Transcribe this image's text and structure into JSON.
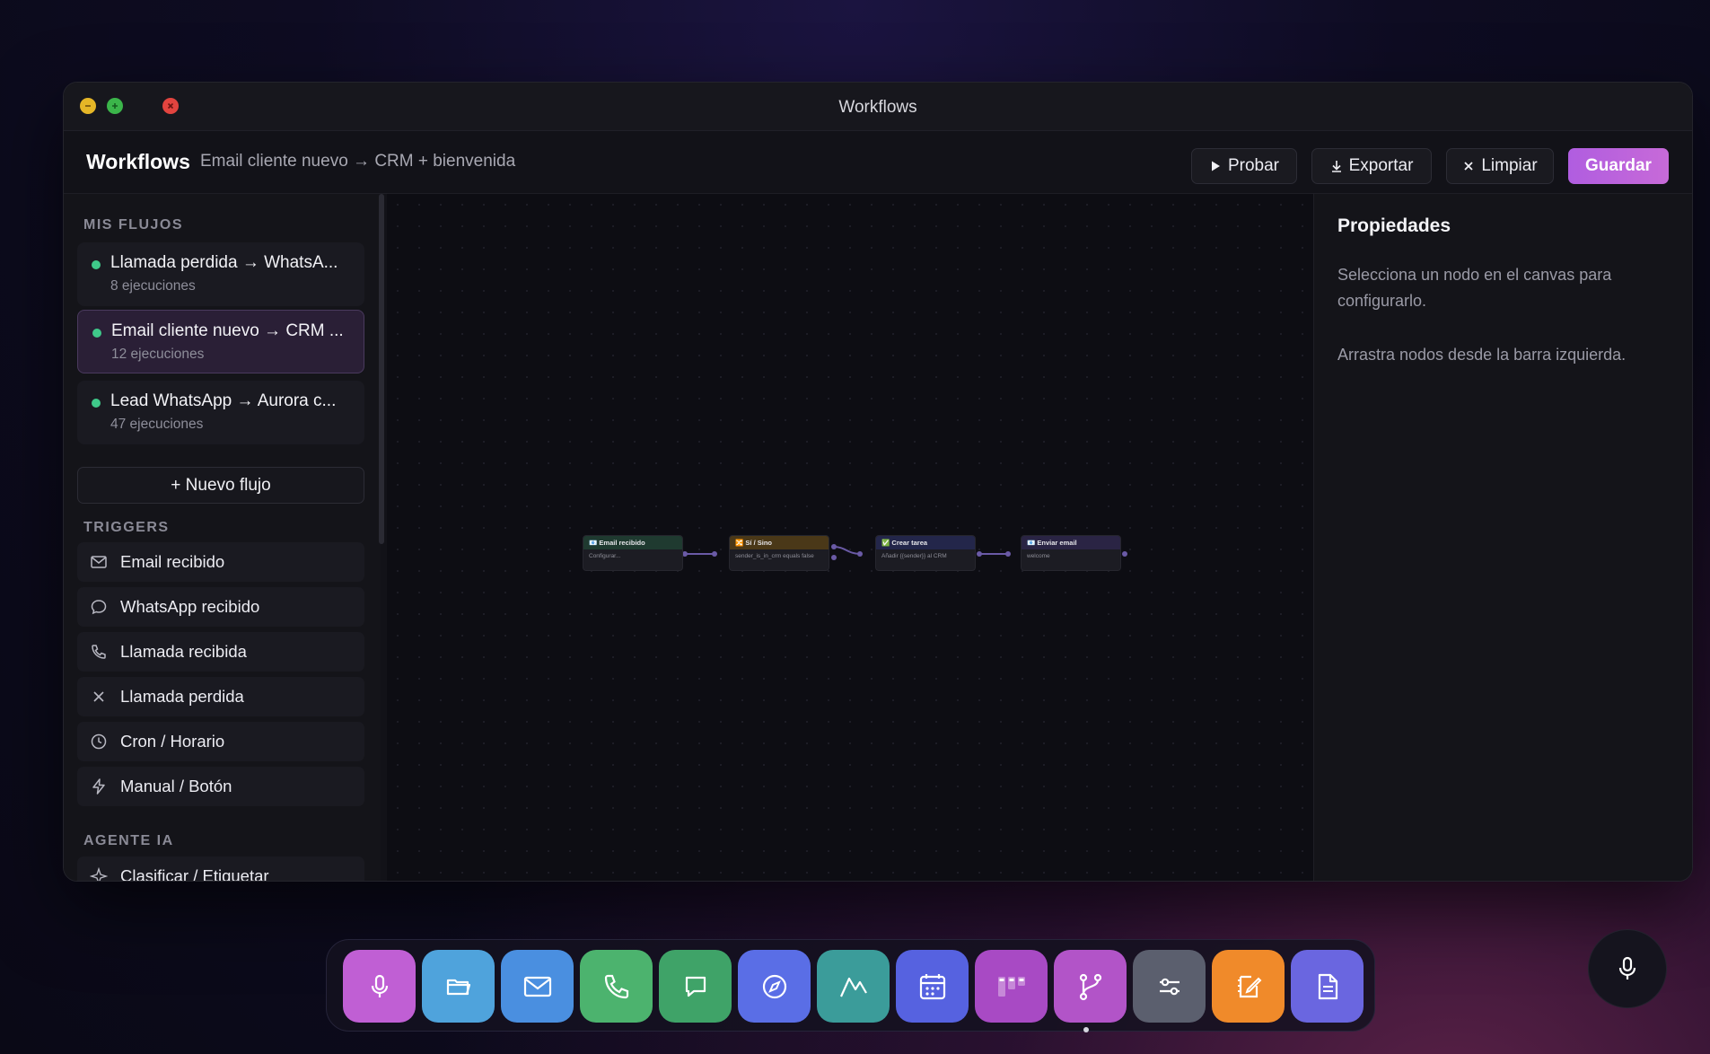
{
  "window": {
    "title": "Workflows"
  },
  "header": {
    "title": "Workflows",
    "subtitle": "Email cliente nuevo → CRM + bienvenida",
    "buttons": {
      "probar": "Probar",
      "exportar": "Exportar",
      "limpiar": "Limpiar",
      "guardar": "Guardar"
    }
  },
  "sidebar": {
    "flows_title": "MIS FLUJOS",
    "flows": [
      {
        "name": "Llamada perdida → WhatsA...",
        "runs": "8 ejecuciones",
        "active": false
      },
      {
        "name": "Email cliente nuevo → CRM ...",
        "runs": "12 ejecuciones",
        "active": true
      },
      {
        "name": "Lead WhatsApp → Aurora c...",
        "runs": "47 ejecuciones",
        "active": false
      }
    ],
    "new_flow": "+ Nuevo flujo",
    "triggers_title": "TRIGGERS",
    "triggers": [
      {
        "label": "Email recibido",
        "icon": "mail-icon"
      },
      {
        "label": "WhatsApp recibido",
        "icon": "chat-icon"
      },
      {
        "label": "Llamada recibida",
        "icon": "phone-icon"
      },
      {
        "label": "Llamada perdida",
        "icon": "x-icon"
      },
      {
        "label": "Cron / Horario",
        "icon": "clock-icon"
      },
      {
        "label": "Manual / Botón",
        "icon": "bolt-icon"
      }
    ],
    "agent_title": "AGENTE IA",
    "agent_items": [
      {
        "label": "Clasificar / Etiquetar",
        "icon": "sparkle-icon"
      }
    ]
  },
  "canvas": {
    "nodes": [
      {
        "title": "📧 Email recibido",
        "body": "Configurar..."
      },
      {
        "title": "🔀 Sí / Sino",
        "body": "sender_is_in_crm equals false"
      },
      {
        "title": "✅ Crear tarea",
        "body": "Añadir {{sender}} al CRM"
      },
      {
        "title": "📧 Enviar email",
        "body": "welcome"
      }
    ]
  },
  "properties": {
    "title": "Propiedades",
    "hint1": "Selecciona un nodo en el canvas para configurarlo.",
    "hint2": "Arrastra nodos desde la barra izquierda."
  },
  "dock": {
    "apps": [
      {
        "name": "voice-icon",
        "color": "#c05fd4"
      },
      {
        "name": "folder-icon",
        "color": "#4fa3dc"
      },
      {
        "name": "mail-icon",
        "color": "#4a8fe0"
      },
      {
        "name": "phone-icon",
        "color": "#4cb36e"
      },
      {
        "name": "message-icon",
        "color": "#3fa368"
      },
      {
        "name": "compass-icon",
        "color": "#5a6ee6"
      },
      {
        "name": "chart-icon",
        "color": "#3b9c9a"
      },
      {
        "name": "calendar-icon",
        "color": "#5662e0"
      },
      {
        "name": "kanban-icon",
        "color": "#a84ac4"
      },
      {
        "name": "workflow-icon",
        "color": "#b254c8"
      },
      {
        "name": "settings-icon",
        "color": "#5b5f6e"
      },
      {
        "name": "notes-icon",
        "color": "#f08a2a"
      },
      {
        "name": "document-icon",
        "color": "#6a66e0"
      }
    ]
  }
}
